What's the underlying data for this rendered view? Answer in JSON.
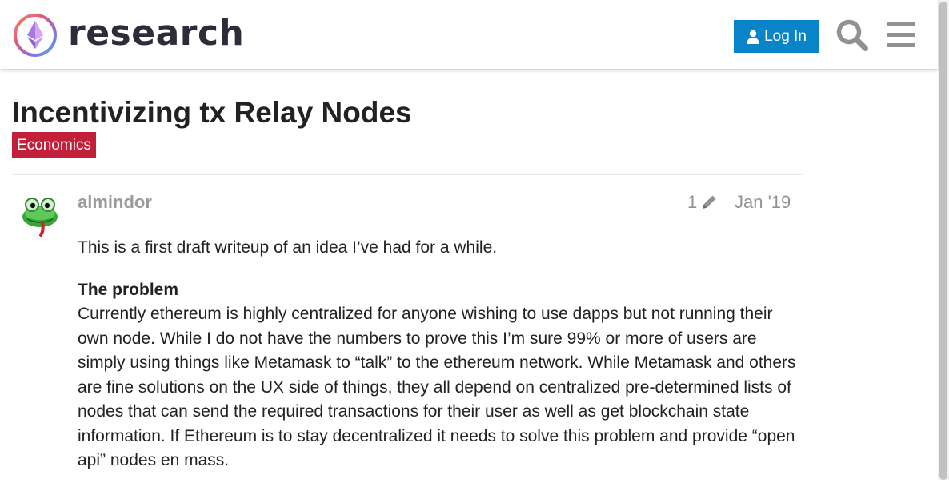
{
  "header": {
    "site_name": "research",
    "login_label": "Log In",
    "icons": [
      "ethereum-logo-icon",
      "user-icon",
      "search-icon",
      "hamburger-menu-icon"
    ],
    "colors": {
      "login_bg": "#0a84c9",
      "category_bg": "#c21f3a"
    }
  },
  "topic": {
    "title": "Incentivizing tx Relay Nodes",
    "category": "Economics"
  },
  "post": {
    "username": "almindor",
    "edit_count": "1",
    "date": "Jan '19",
    "intro": "This is a first draft writeup of an idea I’ve had for a while.",
    "section_heading": "The problem",
    "section_body": "Currently ethereum is highly centralized for anyone wishing to use dapps but not running their own node. While I do not have the numbers to prove this I’m sure 99% or more of users are simply using things like Metamask to “talk” to the ethereum network. While Metamask and others are fine solutions on the UX side of things, they all depend on centralized pre-determined lists of nodes that can send the required transactions for their user as well as get blockchain state information. If Ethereum is to stay decentralized it needs to solve this problem and provide “open api” nodes en mass."
  }
}
